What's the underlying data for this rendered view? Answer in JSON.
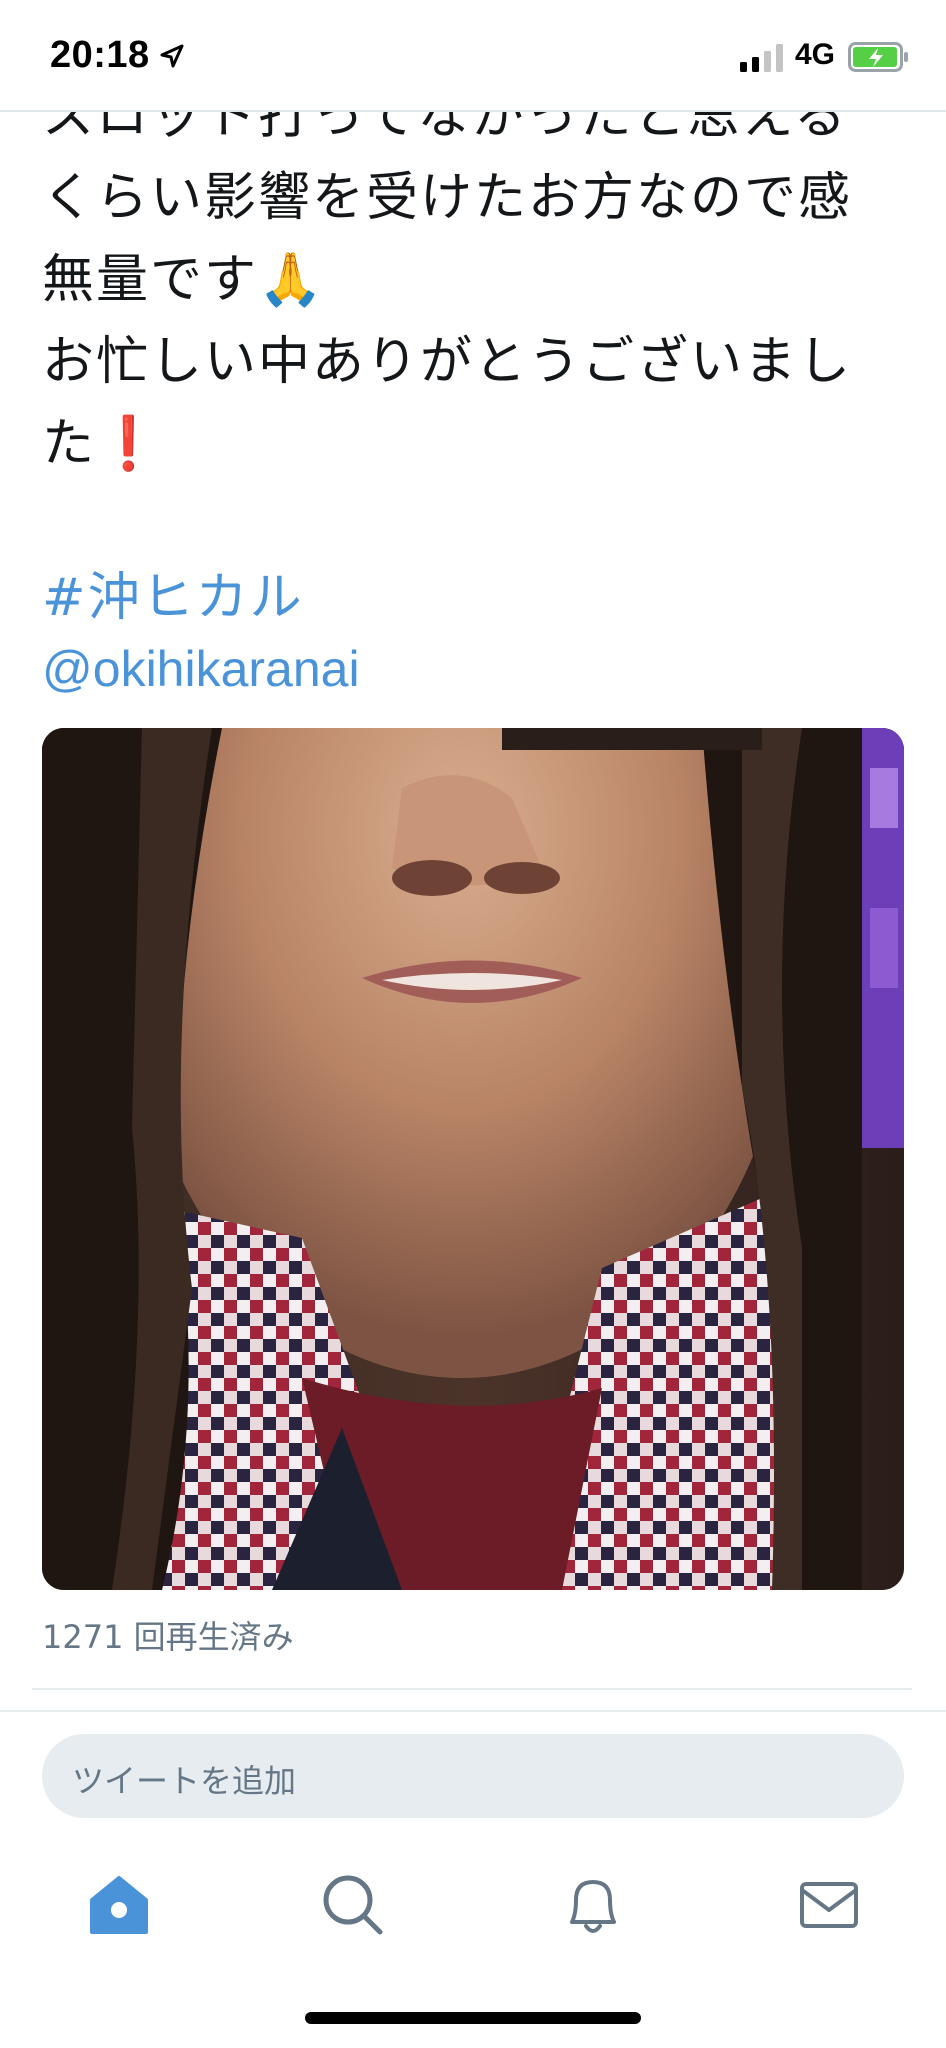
{
  "status_bar": {
    "time": "20:18",
    "network": "4G"
  },
  "tweet": {
    "text": "スロット打ってなかったと思える\nくらい影響を受けたお方なので感\n無量です🙏\nお忙しい中ありがとうございまし\nた❗",
    "hashtag": "#沖ヒカル",
    "mention": "@okihikaranai"
  },
  "video": {
    "play_count": "1271 回再生済み"
  },
  "composer": {
    "placeholder": "ツイートを追加"
  },
  "tabbar": {
    "items": [
      "home-icon",
      "search-icon",
      "bell-icon",
      "mail-icon"
    ],
    "active": "home-icon"
  },
  "colors": {
    "accent": "#4a93d8",
    "muted": "#657786",
    "divider": "#e6ecf0"
  }
}
